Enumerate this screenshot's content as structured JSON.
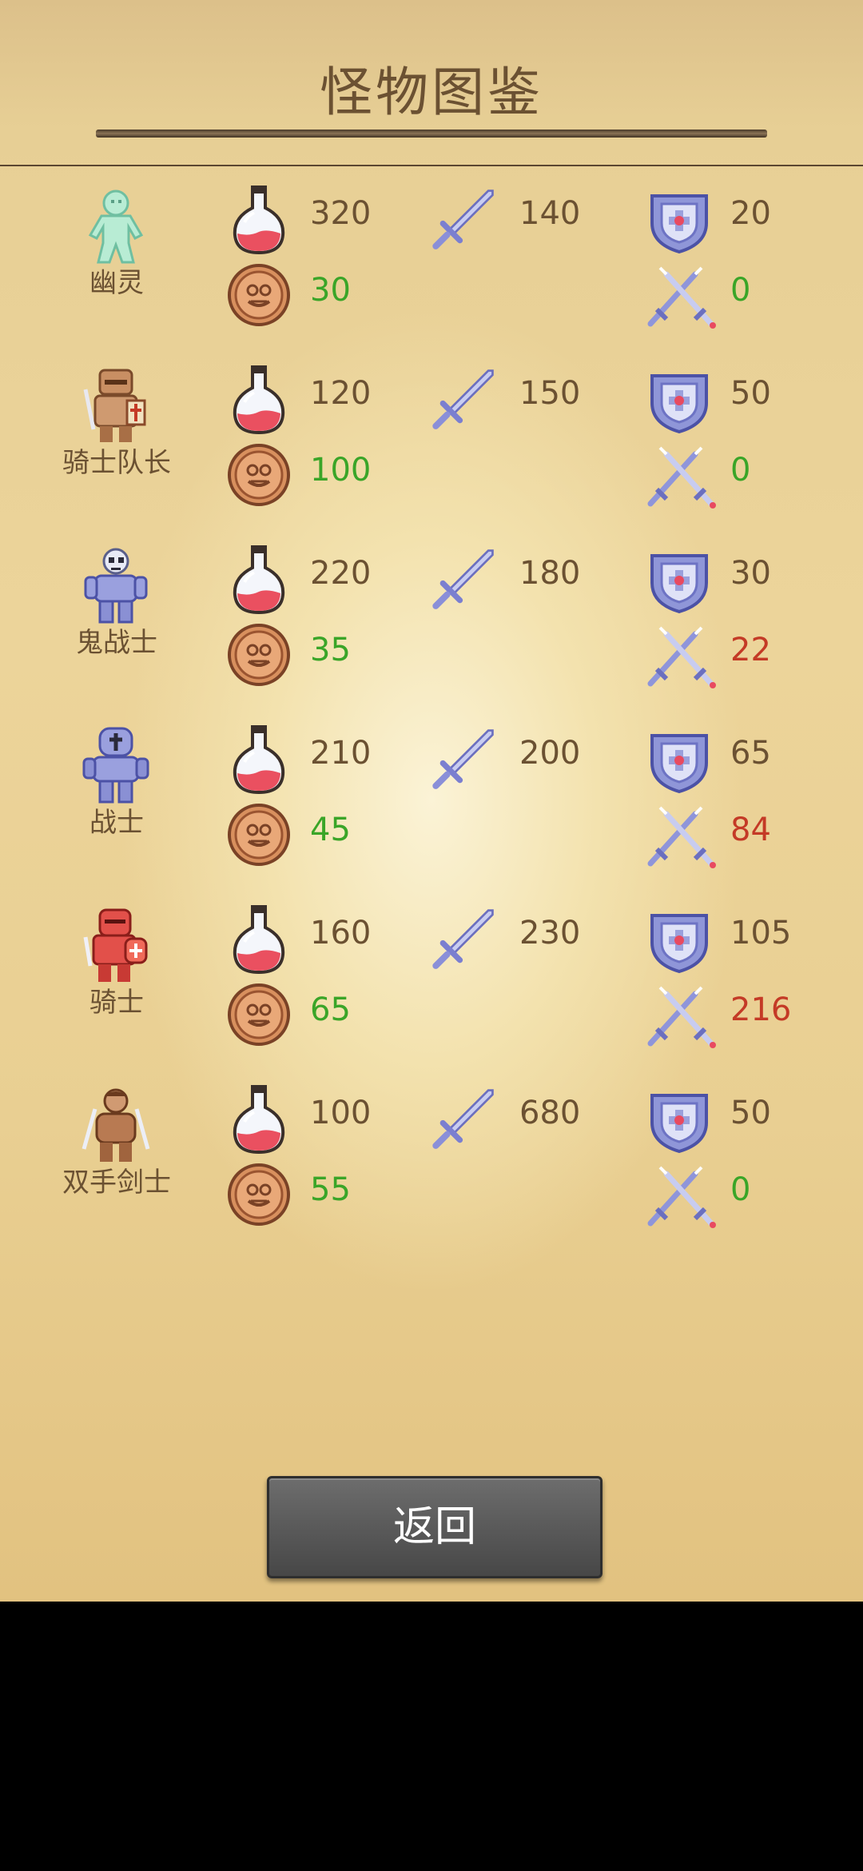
{
  "title": "怪物图鉴",
  "back_label": "返回",
  "colors": {
    "gold_value": "#3aa528",
    "damage_safe": "#3aa528",
    "damage_hurt": "#c43a26",
    "text": "#6b5132"
  },
  "icons": {
    "hp": "potion-icon",
    "atk": "sword-icon",
    "def": "shield-icon",
    "gold": "coin-icon",
    "damage": "crossed-swords-icon"
  },
  "monsters": [
    {
      "name": "幽灵",
      "hp": "320",
      "atk": "140",
      "def": "20",
      "gold": "30",
      "damage": "0",
      "damage_status": "safe",
      "sprite": "ghost-sprite"
    },
    {
      "name": "骑士队长",
      "hp": "120",
      "atk": "150",
      "def": "50",
      "gold": "100",
      "damage": "0",
      "damage_status": "safe",
      "sprite": "knight-captain-sprite"
    },
    {
      "name": "鬼战士",
      "hp": "220",
      "atk": "180",
      "def": "30",
      "gold": "35",
      "damage": "22",
      "damage_status": "hurt",
      "sprite": "ghost-warrior-sprite"
    },
    {
      "name": "战士",
      "hp": "210",
      "atk": "200",
      "def": "65",
      "gold": "45",
      "damage": "84",
      "damage_status": "hurt",
      "sprite": "warrior-sprite"
    },
    {
      "name": "骑士",
      "hp": "160",
      "atk": "230",
      "def": "105",
      "gold": "65",
      "damage": "216",
      "damage_status": "hurt",
      "sprite": "knight-sprite"
    },
    {
      "name": "双手剑士",
      "hp": "100",
      "atk": "680",
      "def": "50",
      "gold": "55",
      "damage": "0",
      "damage_status": "safe",
      "sprite": "two-handed-swordsman-sprite"
    }
  ]
}
